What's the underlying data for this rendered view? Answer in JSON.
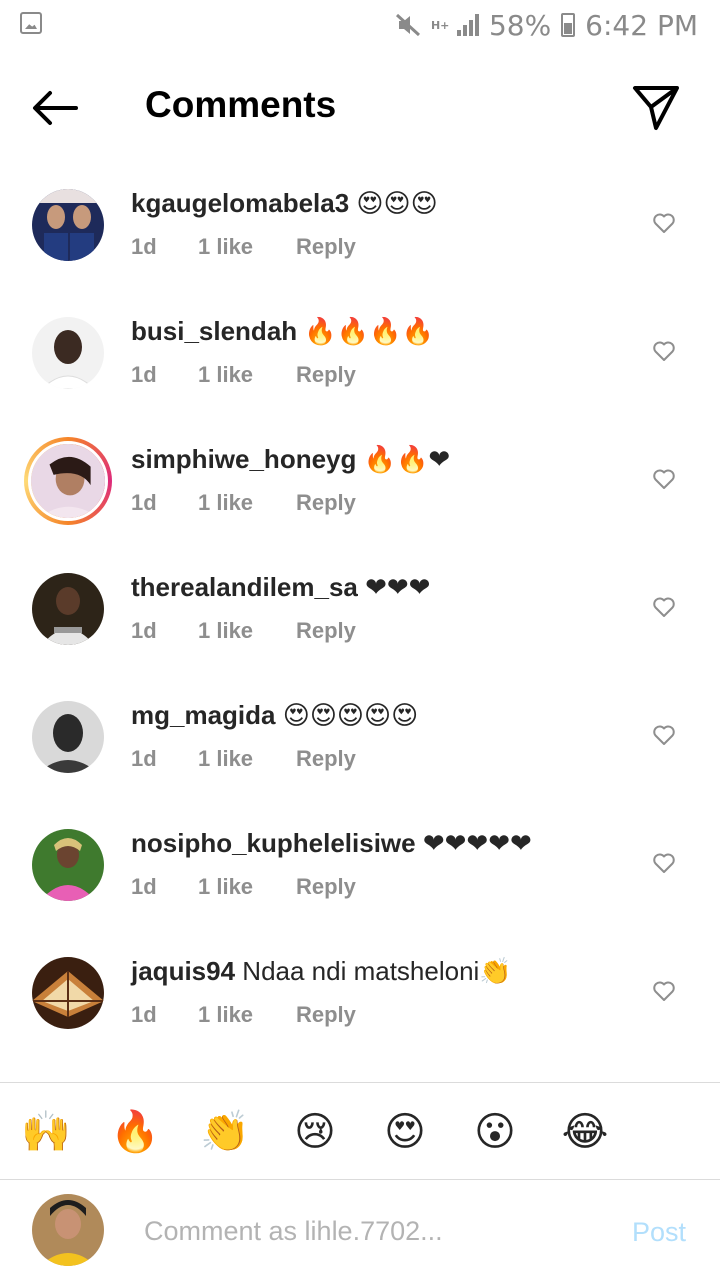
{
  "status_bar": {
    "network": "H+",
    "battery": "58%",
    "time": "6:42 PM"
  },
  "header": {
    "title": "Comments",
    "back_icon": "arrow-left-icon",
    "share_icon": "paper-plane-icon"
  },
  "comments": [
    {
      "username": "kgaugelomabela3",
      "text": " 😍😍😍",
      "time": "1d",
      "likes": "1 like",
      "reply": "Reply",
      "story_ring": false
    },
    {
      "username": "busi_slendah",
      "text": " 🔥🔥🔥🔥",
      "time": "1d",
      "likes": "1 like",
      "reply": "Reply",
      "story_ring": false
    },
    {
      "username": "simphiwe_honeyg",
      "text": " 🔥🔥❤",
      "time": "1d",
      "likes": "1 like",
      "reply": "Reply",
      "story_ring": true
    },
    {
      "username": "therealandilem_sa",
      "text": " ❤❤❤",
      "time": "1d",
      "likes": "1 like",
      "reply": "Reply",
      "story_ring": false
    },
    {
      "username": "mg_magida",
      "text": " 😍😍😍😍😍",
      "time": "1d",
      "likes": "1 like",
      "reply": "Reply",
      "story_ring": false
    },
    {
      "username": "nosipho_kuphelelisiwe",
      "text": " ❤❤❤❤❤",
      "time": "1d",
      "likes": "1 like",
      "reply": "Reply",
      "story_ring": false
    },
    {
      "username": "jaquis94",
      "text": " Ndaa ndi matsheloni👏",
      "time": "1d",
      "likes": "1 like",
      "reply": "Reply",
      "story_ring": false
    }
  ],
  "emoji_bar": [
    "🙌",
    "🔥",
    "👏",
    "😢",
    "😍",
    "😮",
    "😂"
  ],
  "composer": {
    "placeholder": "Comment as lihle.7702...",
    "post_label": "Post"
  },
  "colors": {
    "post_disabled": "#b2dffc",
    "meta_gray": "#8e8e8e",
    "story_ring": "#dd2a7b"
  }
}
